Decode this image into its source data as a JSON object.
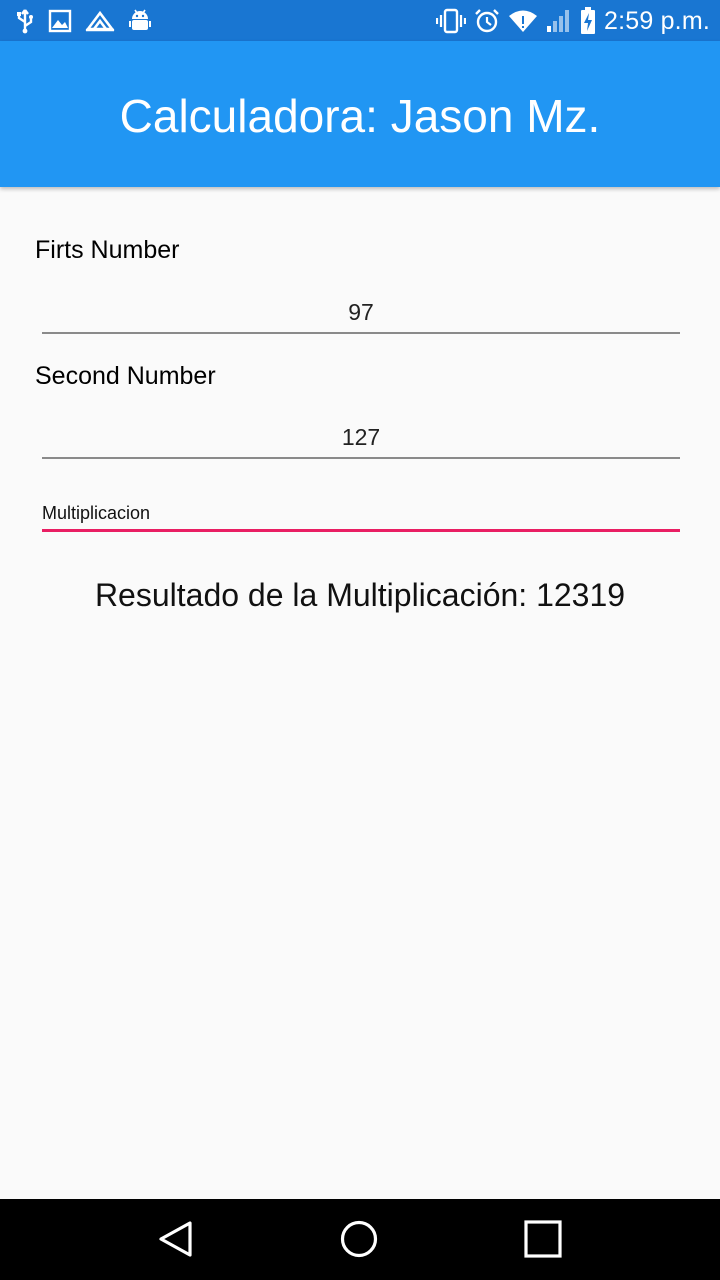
{
  "status_bar": {
    "time": "2:59 p.m.",
    "left_icons": [
      "usb-icon",
      "image-icon",
      "cloud-sync-icon",
      "android-debug-icon"
    ],
    "right_icons": [
      "vibrate-icon",
      "alarm-icon",
      "wifi-icon",
      "signal-icon",
      "battery-charging-icon"
    ]
  },
  "app_bar": {
    "title": "Calculadora: Jason Mz."
  },
  "form": {
    "first_label": "Firts Number",
    "first_value": "97",
    "second_label": "Second Number",
    "second_value": "127",
    "operation_selected": "Multiplicacion"
  },
  "result": {
    "text": "Resultado de la Multiplicación: 12319"
  },
  "colors": {
    "status_bar": "#1976d2",
    "app_bar": "#2196f3",
    "accent": "#e91e63",
    "background": "#fafafa"
  },
  "nav_bar": {
    "icons": [
      "back-icon",
      "home-icon",
      "recents-icon"
    ]
  }
}
